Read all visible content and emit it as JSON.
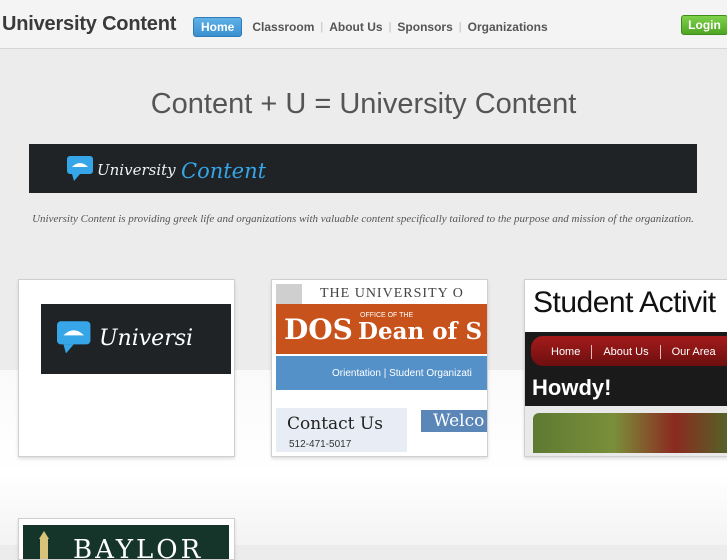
{
  "header": {
    "brand": "University Content",
    "nav": [
      {
        "label": "Home",
        "active": true
      },
      {
        "label": "Classroom"
      },
      {
        "label": "About Us"
      },
      {
        "label": "Sponsors"
      },
      {
        "label": "Organizations"
      }
    ],
    "login_label": "Login"
  },
  "hero": {
    "title": "Content + U = University Content",
    "banner_word1": "University",
    "banner_word2": "Content",
    "tagline": "University Content is providing greek life and organizations with valuable content specifically tailored to the purpose and mission of the organization."
  },
  "cards": {
    "card1": {
      "logo_text": "Universi"
    },
    "card2": {
      "header": "THE UNIVERSITY O",
      "dos": "DOS",
      "office": "OFFICE OF THE",
      "dean": "Dean of S",
      "nav": "Orientation  |  Student Organizati",
      "contact_title": "Contact Us",
      "phone": "512-471-5017",
      "welcome": "Welco"
    },
    "card3": {
      "title": "Student Activit",
      "nav": [
        "Home",
        "About Us",
        "Our Area"
      ],
      "howdy": "Howdy!"
    },
    "card4": {
      "text": "BAYLOR"
    }
  },
  "colors": {
    "accent_blue": "#3a8fd0",
    "login_green": "#4fa524",
    "banner_dark": "#1f2326",
    "brand_blue": "#36a6e8"
  }
}
